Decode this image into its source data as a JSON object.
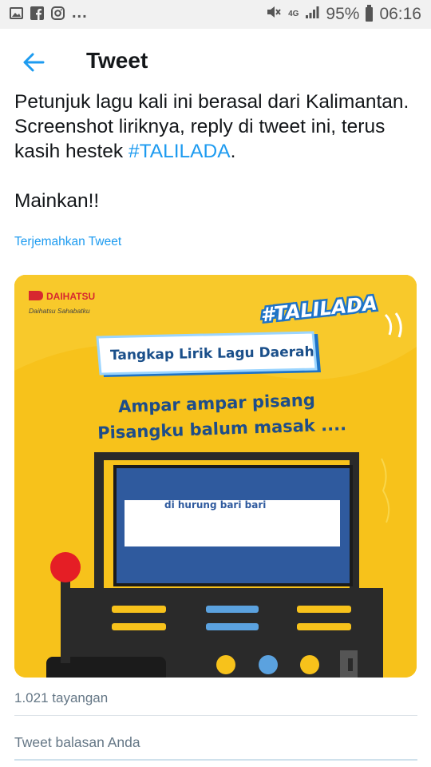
{
  "status_bar": {
    "left_more": "...",
    "network": "4G",
    "battery": "95%",
    "time": "06:16",
    "icons": [
      "image-icon",
      "facebook-icon",
      "instagram-icon",
      "mute-icon",
      "signal-icon",
      "battery-icon"
    ]
  },
  "header": {
    "title": "Tweet",
    "back_icon": "arrow-left-icon"
  },
  "tweet": {
    "text_line1": "Petunjuk lagu kali ini berasal dari Kalimantan. Screenshot liriknya, reply di tweet ini, terus kasih hestek ",
    "hashtag": "#TALILADA",
    "text_line1_end": ".",
    "text_line2": "Mainkan!!",
    "translate_label": "Terjemahkan Tweet",
    "views": "1.021 tayangan"
  },
  "media": {
    "brand": "DAIHATSU",
    "brand_tagline": "Daihatsu Sahabatku",
    "hashtag_badge": "#TALILADA",
    "banner": "Tangkap Lirik Lagu Daerah",
    "lyric_line1": "Ampar ampar pisang",
    "lyric_line2": "Pisangku balum masak ....",
    "screen_text": "di hurung bari bari",
    "colors": {
      "background": "#f7c21b",
      "screen": "#2f5a9e",
      "brand_red": "#d7282f"
    }
  },
  "reply": {
    "placeholder": "Tweet balasan Anda"
  },
  "colors": {
    "accent": "#1d9bf0",
    "muted": "#657786"
  }
}
